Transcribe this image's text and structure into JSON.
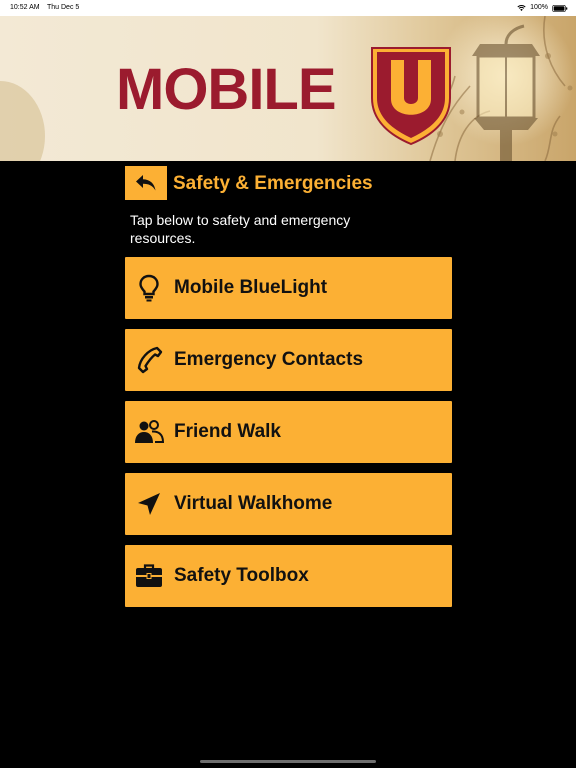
{
  "status_bar": {
    "time": "10:52 AM",
    "date": "Thu Dec 5",
    "battery": "100%"
  },
  "banner": {
    "logo_text": "MOBILE",
    "shield_letter": "U",
    "colors": {
      "maroon": "#9b1b2e",
      "gold": "#fcb034"
    }
  },
  "header": {
    "back_icon": "back-arrow-icon",
    "title": "Safety & Emergencies"
  },
  "description": "Tap below to safety and emergency resources.",
  "menu": {
    "items": [
      {
        "label": "Mobile BlueLight",
        "icon": "lightbulb-icon"
      },
      {
        "label": "Emergency Contacts",
        "icon": "phone-icon"
      },
      {
        "label": "Friend Walk",
        "icon": "people-icon"
      },
      {
        "label": "Virtual Walkhome",
        "icon": "navigation-arrow-icon"
      },
      {
        "label": "Safety Toolbox",
        "icon": "toolbox-icon"
      }
    ]
  },
  "theme": {
    "accent": "#fcb034",
    "background": "#000000",
    "text_dark": "#111111"
  }
}
